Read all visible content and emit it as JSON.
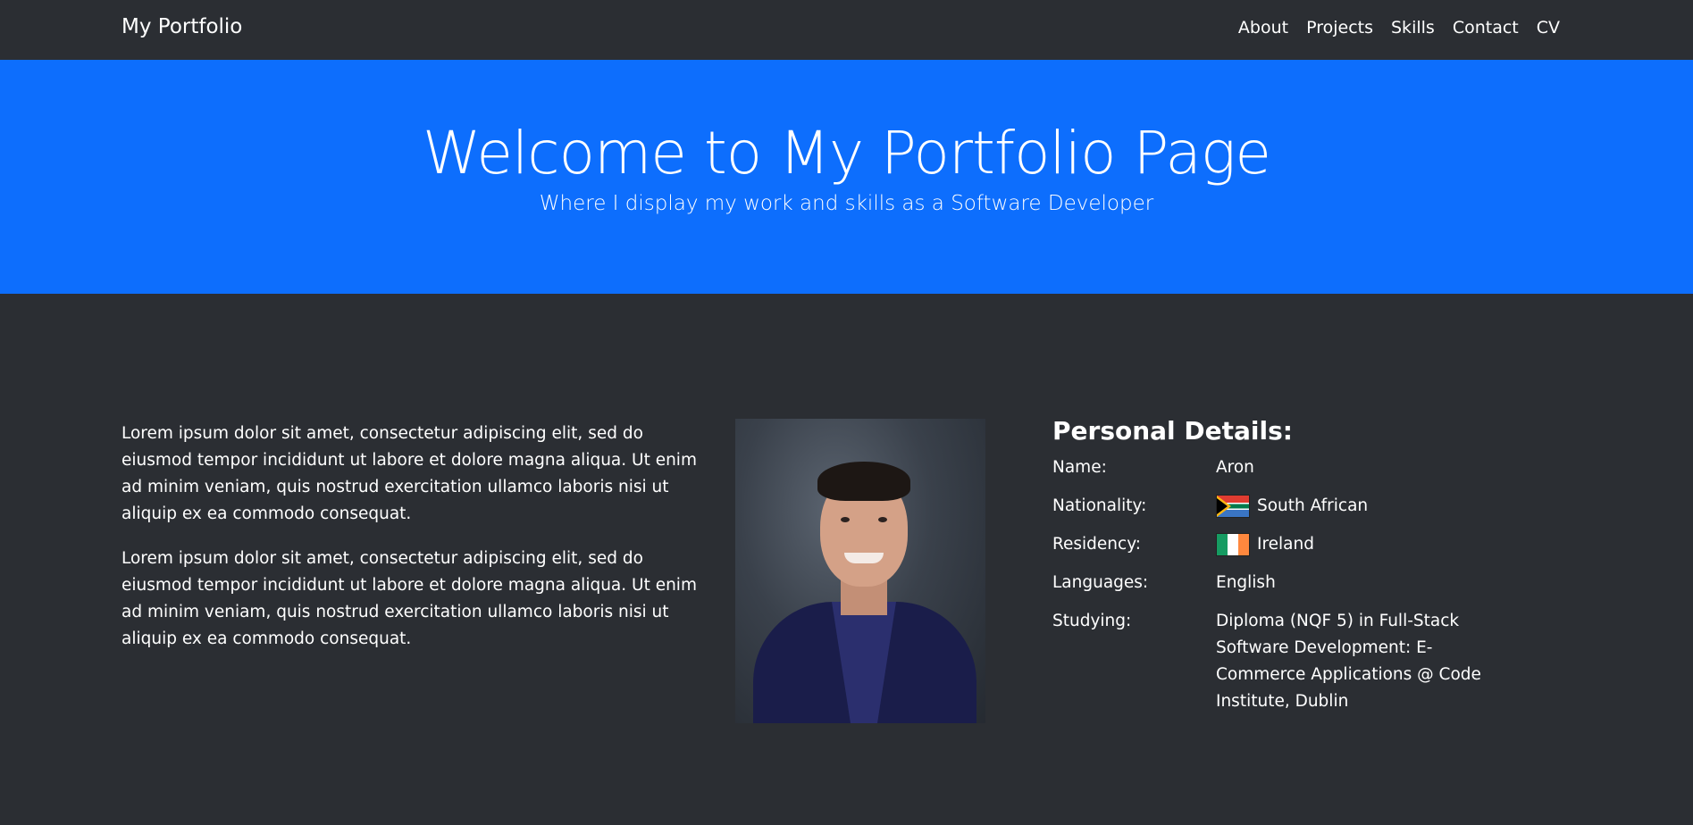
{
  "navbar": {
    "brand": "My Portfolio",
    "links": [
      "About",
      "Projects",
      "Skills",
      "Contact",
      "CV"
    ]
  },
  "hero": {
    "title": "Welcome to My Portfolio Page",
    "subtitle": "Where I display my work and skills as a Software Developer",
    "background": "#0d6efd"
  },
  "about": {
    "paragraphs": [
      "Lorem ipsum dolor sit amet, consectetur adipiscing elit, sed do eiusmod tempor incididunt ut labore et dolore magna aliqua. Ut enim ad minim veniam, quis nostrud exercitation ullamco laboris nisi ut aliquip ex ea commodo consequat.",
      "Lorem ipsum dolor sit amet, consectetur adipiscing elit, sed do eiusmod tempor incididunt ut labore et dolore magna aliqua. Ut enim ad minim veniam, quis nostrud exercitation ullamco laboris nisi ut aliquip ex ea commodo consequat."
    ]
  },
  "details": {
    "title": "Personal Details:",
    "rows": [
      {
        "label": "Name:",
        "value": "Aron"
      },
      {
        "label": "Nationality:",
        "value": "South African",
        "flag": "south-africa-flag-icon"
      },
      {
        "label": "Residency:",
        "value": "Ireland",
        "flag": "ireland-flag-icon"
      },
      {
        "label": "Languages:",
        "value": "English"
      },
      {
        "label": "Studying:",
        "value": "Diploma (NQF 5) in Full-Stack Software Development: E-Commerce Applications @ Code Institute, Dublin"
      }
    ]
  },
  "colors": {
    "page_background": "#2b2e33",
    "navbar_background": "#2b2e33",
    "hero_background": "#0d6efd"
  }
}
